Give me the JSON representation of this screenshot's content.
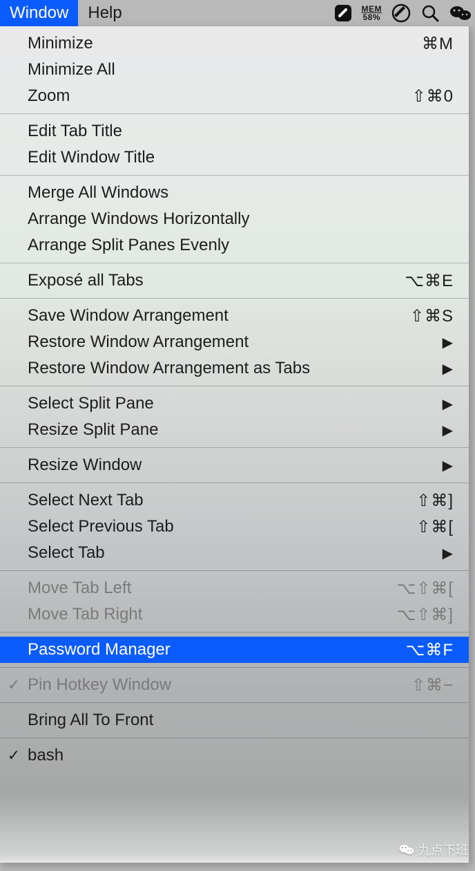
{
  "menubar": {
    "window": "Window",
    "help": "Help",
    "mem_label": "MEM",
    "mem_value": "58%"
  },
  "menu": {
    "groups": [
      [
        {
          "label": "Minimize",
          "accel": "⌘M",
          "disabled": false,
          "submenu": false,
          "check": false,
          "highlight": false
        },
        {
          "label": "Minimize All",
          "accel": "",
          "disabled": false,
          "submenu": false,
          "check": false,
          "highlight": false
        },
        {
          "label": "Zoom",
          "accel": "⇧⌘0",
          "disabled": false,
          "submenu": false,
          "check": false,
          "highlight": false
        }
      ],
      [
        {
          "label": "Edit Tab Title",
          "accel": "",
          "disabled": false,
          "submenu": false,
          "check": false,
          "highlight": false
        },
        {
          "label": "Edit Window Title",
          "accel": "",
          "disabled": false,
          "submenu": false,
          "check": false,
          "highlight": false
        }
      ],
      [
        {
          "label": "Merge All Windows",
          "accel": "",
          "disabled": false,
          "submenu": false,
          "check": false,
          "highlight": false
        },
        {
          "label": "Arrange Windows Horizontally",
          "accel": "",
          "disabled": false,
          "submenu": false,
          "check": false,
          "highlight": false
        },
        {
          "label": "Arrange Split Panes Evenly",
          "accel": "",
          "disabled": false,
          "submenu": false,
          "check": false,
          "highlight": false
        }
      ],
      [
        {
          "label": "Exposé all Tabs",
          "accel": "⌥⌘E",
          "disabled": false,
          "submenu": false,
          "check": false,
          "highlight": false
        }
      ],
      [
        {
          "label": "Save Window Arrangement",
          "accel": "⇧⌘S",
          "disabled": false,
          "submenu": false,
          "check": false,
          "highlight": false
        },
        {
          "label": "Restore Window Arrangement",
          "accel": "",
          "disabled": false,
          "submenu": true,
          "check": false,
          "highlight": false
        },
        {
          "label": "Restore Window Arrangement as Tabs",
          "accel": "",
          "disabled": false,
          "submenu": true,
          "check": false,
          "highlight": false
        }
      ],
      [
        {
          "label": "Select Split Pane",
          "accel": "",
          "disabled": false,
          "submenu": true,
          "check": false,
          "highlight": false
        },
        {
          "label": "Resize Split Pane",
          "accel": "",
          "disabled": false,
          "submenu": true,
          "check": false,
          "highlight": false
        }
      ],
      [
        {
          "label": "Resize Window",
          "accel": "",
          "disabled": false,
          "submenu": true,
          "check": false,
          "highlight": false
        }
      ],
      [
        {
          "label": "Select Next Tab",
          "accel": "⇧⌘]",
          "disabled": false,
          "submenu": false,
          "check": false,
          "highlight": false
        },
        {
          "label": "Select Previous Tab",
          "accel": "⇧⌘[",
          "disabled": false,
          "submenu": false,
          "check": false,
          "highlight": false
        },
        {
          "label": "Select Tab",
          "accel": "",
          "disabled": false,
          "submenu": true,
          "check": false,
          "highlight": false
        }
      ],
      [
        {
          "label": "Move Tab Left",
          "accel": "⌥⇧⌘[",
          "disabled": true,
          "submenu": false,
          "check": false,
          "highlight": false
        },
        {
          "label": "Move Tab Right",
          "accel": "⌥⇧⌘]",
          "disabled": true,
          "submenu": false,
          "check": false,
          "highlight": false
        }
      ],
      [
        {
          "label": "Password Manager",
          "accel": "⌥⌘F",
          "disabled": false,
          "submenu": false,
          "check": false,
          "highlight": true
        }
      ],
      [
        {
          "label": "Pin Hotkey Window",
          "accel": "⇧⌘−",
          "disabled": true,
          "submenu": false,
          "check": true,
          "highlight": false
        }
      ],
      [
        {
          "label": "Bring All To Front",
          "accel": "",
          "disabled": false,
          "submenu": false,
          "check": false,
          "highlight": false
        }
      ],
      [
        {
          "label": "bash",
          "accel": "",
          "disabled": false,
          "submenu": false,
          "check": true,
          "highlight": false
        }
      ]
    ]
  },
  "watermark": {
    "text": "九点下班"
  }
}
